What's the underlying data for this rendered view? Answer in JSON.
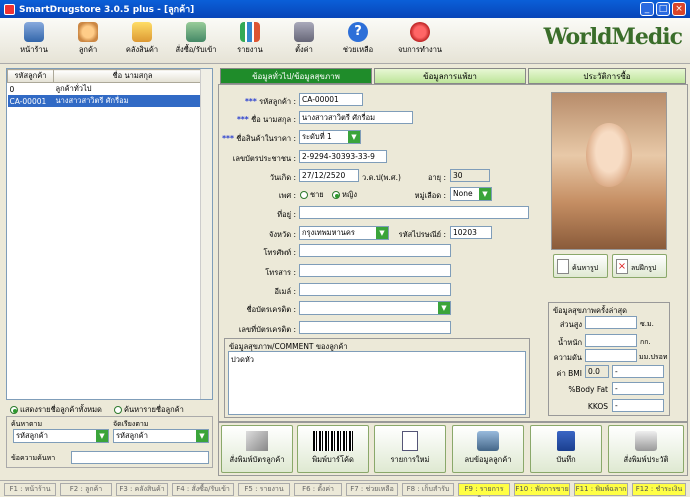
{
  "window": {
    "title": "SmartDrugstore 3.0.5 plus - [ลูกค้า]"
  },
  "toolbar": {
    "buttons": [
      {
        "label": "หน้าร้าน"
      },
      {
        "label": "ลูกค้า"
      },
      {
        "label": "คลังสินค้า"
      },
      {
        "label": "สั่งซื้อ/รับเข้า"
      },
      {
        "label": "รายงาน"
      },
      {
        "label": "ตั้งค่า"
      },
      {
        "label": "ช่วยเหลือ"
      },
      {
        "label": "จบการทำงาน"
      }
    ],
    "logo": "WorldMedic"
  },
  "customer_list": {
    "columns": [
      "รหัสลูกค้า",
      "ชื่อ นามสกุล"
    ],
    "rows": [
      {
        "code": "0",
        "name": "ลูกค้าทั่วไป"
      },
      {
        "code": "CA-00001",
        "name": "นางสาวสาวิตรี ศักรื่อม"
      }
    ],
    "show_all_label": "แสดงรายชื่อลูกค้าทั้งหมด",
    "search_label": "ค้นหารายชื่อลูกค้า",
    "search_by_label": "ค้นหาตาม",
    "search_by_value": "รหัสลูกค้า",
    "sort_by_label": "จัดเรียงตาม",
    "sort_by_value": "รหัสลูกค้า",
    "search_text_label": "ข้อความค้นหา"
  },
  "tabs": [
    "ข้อมูลทั่วไป/ข้อมูลสุขภาพ",
    "ข้อมูลการแพ้ยา",
    "ประวัติการซื้อ"
  ],
  "form": {
    "required_mark": "***",
    "customer_code_label": "รหัสลูกค้า :",
    "customer_code": "CA-00001",
    "name_label": "ชื่อ นามสกุล :",
    "name": "นางสาวสาวิตรี ศักรื่อม",
    "price_level_label": "ชื่อสินค้าในราคา :",
    "price_level": "ระดับที่ 1",
    "id_card_label": "เลขบัตรประชาชน :",
    "id_card": "2-9294-30393-33-9",
    "birth_label": "วันเกิด :",
    "birth": "27/12/2520",
    "birth_unit": "ว.ด.ป(พ.ศ.)",
    "age_label": "อายุ :",
    "age": "30",
    "sex_label": "เพศ :",
    "sex_male": "ชาย",
    "sex_female": "หญิง",
    "blood_label": "หมู่เลือด :",
    "blood": "None",
    "address_label": "ที่อยู่ :",
    "province_label": "จังหวัด :",
    "province": "กรุงเทพมหานคร",
    "postal_label": "รหัสไปรษณีย์ :",
    "postal": "10203",
    "phone_label": "โทรศัพท์ :",
    "fax_label": "โทรสาร :",
    "email_label": "อีเมล์ :",
    "card_name_label": "ชื่อบัตรเครดิต :",
    "card_no_label": "เลขที่บัตรเครดิต :",
    "comment_label": "ข้อมูลสุขภาพ/COMMENT ของลูกค้า",
    "comment": "ปวดหัว"
  },
  "photo": {
    "find_label": "ค้นหารูป",
    "delete_label": "ลบฝึกรูป"
  },
  "health": {
    "title": "ข้อมูลสุขภาพครั้งล่าสุด",
    "height_label": "ส่วนสูง",
    "height_unit": "ซ.ม.",
    "weight_label": "น้ำหนัก",
    "weight_unit": "กก.",
    "pressure_label": "ความดัน",
    "pressure_unit": "มม.ปรอท",
    "bmi_label": "ค่า BMI",
    "bmi": "0.0",
    "bmi_suffix": "-",
    "bodyfat_label": "%Body Fat",
    "bodyfat": "-",
    "kkos_label": "KKOS",
    "kkos": "-"
  },
  "actions": [
    {
      "label": "สั่งพิมพ์บัตรลูกค้า"
    },
    {
      "label": "พิมพ์บาร์โค้ด"
    },
    {
      "label": "รายการใหม่"
    },
    {
      "label": "ลบข้อมูลลูกค้า"
    },
    {
      "label": "บันทึก"
    },
    {
      "label": "สั่งพิมพ์ประวัติ"
    }
  ],
  "fkeys": [
    {
      "label": "F1 : หน้าร้าน"
    },
    {
      "label": "F2 : ลูกค้า"
    },
    {
      "label": "F3 : คลังสินค้า"
    },
    {
      "label": "F4 : สั่งซื้อ/รับเข้า"
    },
    {
      "label": "F5 : รายงาน"
    },
    {
      "label": "F6 : ตั้งค่า"
    },
    {
      "label": "F7 : ช่วยเหลือ"
    },
    {
      "label": "F8 : เก็บสำรับ"
    },
    {
      "label": "F9 : รายการใหม่"
    },
    {
      "label": "F10 : พักการขาย"
    },
    {
      "label": "F11 : พิมพ์ฉลาก"
    },
    {
      "label": "F12 : ชำระเงิน"
    }
  ]
}
